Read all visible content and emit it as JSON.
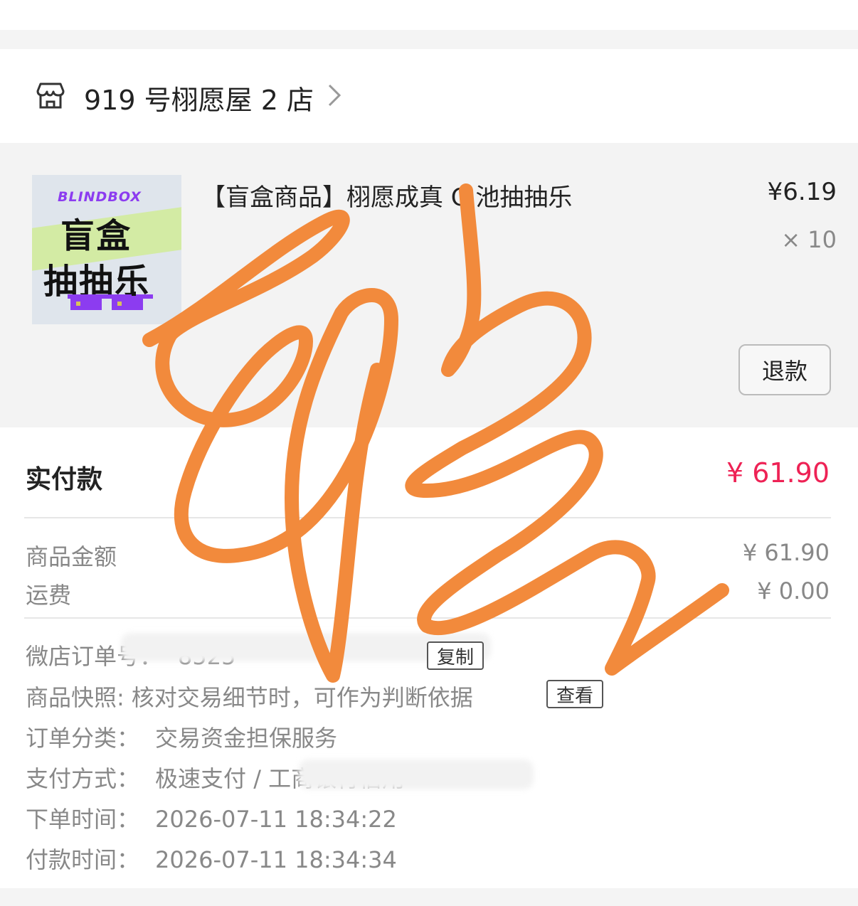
{
  "shop": {
    "name": "919 号栩愿屋 2 店"
  },
  "product": {
    "thumb_tag": "BLINDBOX",
    "thumb_line1": "盲盒",
    "thumb_line2": "抽抽乐",
    "title": "【盲盒商品】栩愿成真 C 池抽抽乐",
    "price": "¥6.19",
    "quantity": "× 10",
    "refund_label": "退款"
  },
  "summary": {
    "paid_label": "实付款",
    "paid_value": "¥ 61.90",
    "goods_label": "商品金额",
    "goods_value": "¥ 61.90",
    "shipping_label": "运费",
    "shipping_value": "¥ 0.00"
  },
  "order_info": {
    "order_no_label": "微店订单号：",
    "order_no_value": "8525",
    "copy_label": "复制",
    "snapshot_label": "商品快照:",
    "snapshot_value": "核对交易细节时，可作为判断依据",
    "view_label": "查看",
    "category_label": "订单分类：",
    "category_value": "交易资金担保服务",
    "payment_label": "支付方式：",
    "payment_value": "极速支付 / 工商银行信用",
    "order_time_label": "下单时间：",
    "order_time_value": "2026-07-11 18:34:22",
    "pay_time_label": "付款时间：",
    "pay_time_value": "2026-07-11 18:34:34"
  },
  "colors": {
    "accent_red": "#ee2255",
    "doodle_orange": "#f28a3c",
    "thumb_purple": "#8c3cf0"
  }
}
